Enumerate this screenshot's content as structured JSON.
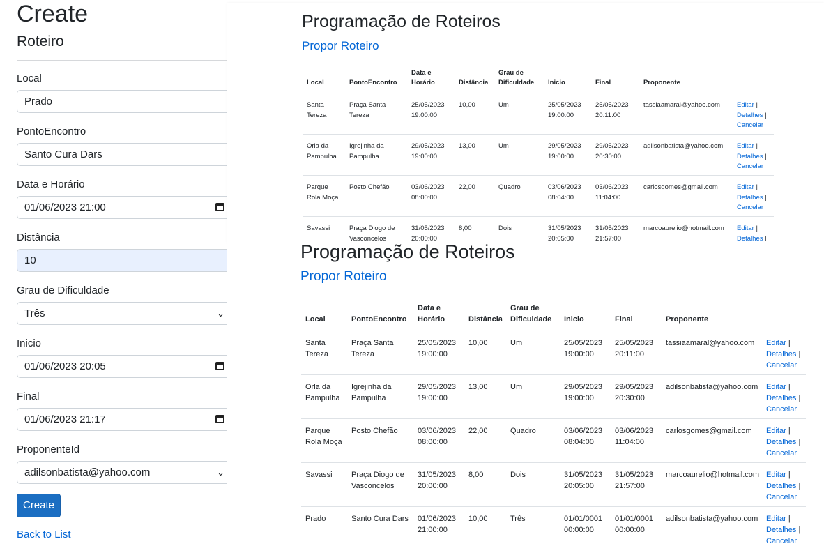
{
  "create_form": {
    "title": "Create",
    "subtitle": "Roteiro",
    "fields": {
      "local": {
        "label": "Local",
        "value": "Prado"
      },
      "ponto": {
        "label": "PontoEncontro",
        "value": "Santo Cura Dars"
      },
      "data": {
        "label": "Data e Horário",
        "value": "01/06/2023 21:00"
      },
      "distancia": {
        "label": "Distância",
        "value": "10"
      },
      "grau": {
        "label": "Grau de Dificuldade",
        "value": "Três"
      },
      "inicio": {
        "label": "Inicio",
        "value": "01/06/2023 20:05"
      },
      "final": {
        "label": "Final",
        "value": "01/06/2023 21:17"
      },
      "proponente": {
        "label": "ProponenteId",
        "value": "adilsonbatista@yahoo.com"
      }
    },
    "submit_label": "Create",
    "back_link": "Back to List"
  },
  "list_before": {
    "title": "Programação de Roteiros",
    "propose_link": "Propor Roteiro",
    "headers": [
      "Local",
      "PontoEncontro",
      "Data e\nHorário",
      "Distância",
      "Grau de\nDificuldade",
      "Inicio",
      "Final",
      "Proponente",
      ""
    ],
    "rows": [
      {
        "local": "Santa\nTereza",
        "ponto": "Praça Santa\nTereza",
        "data": "25/05/2023\n19:00:00",
        "distancia": "10,00",
        "grau": "Um",
        "inicio": "25/05/2023\n19:00:00",
        "final": "25/05/2023\n20:11:00",
        "proponente": "tassiaamaral@yahoo.com"
      },
      {
        "local": "Orla da\nPampulha",
        "ponto": "Igrejinha da\nPampulha",
        "data": "29/05/2023\n19:00:00",
        "distancia": "13,00",
        "grau": "Um",
        "inicio": "29/05/2023\n19:00:00",
        "final": "29/05/2023\n20:30:00",
        "proponente": "adilsonbatista@yahoo.com"
      },
      {
        "local": "Parque\nRola Moça",
        "ponto": "Posto Chefão",
        "data": "03/06/2023\n08:00:00",
        "distancia": "22,00",
        "grau": "Quadro",
        "inicio": "03/06/2023\n08:04:00",
        "final": "03/06/2023\n11:04:00",
        "proponente": "carlosgomes@gmail.com"
      },
      {
        "local": "Savassi",
        "ponto": "Praça Diogo de\nVasconcelos",
        "data": "31/05/2023\n20:00:00",
        "distancia": "8,00",
        "grau": "Dois",
        "inicio": "31/05/2023\n20:05:00",
        "final": "31/05/2023\n21:57:00",
        "proponente": "marcoaurelio@hotmail.com"
      }
    ]
  },
  "list_after": {
    "title": "Programação de Roteiros",
    "propose_link": "Propor Roteiro",
    "headers": [
      "Local",
      "PontoEncontro",
      "Data e\nHorário",
      "Distância",
      "Grau de\nDificuldade",
      "Inicio",
      "Final",
      "Proponente",
      ""
    ],
    "rows": [
      {
        "local": "Santa\nTereza",
        "ponto": "Praça Santa\nTereza",
        "data": "25/05/2023\n19:00:00",
        "distancia": "10,00",
        "grau": "Um",
        "inicio": "25/05/2023\n19:00:00",
        "final": "25/05/2023\n20:11:00",
        "proponente": "tassiaamaral@yahoo.com"
      },
      {
        "local": "Orla da\nPampulha",
        "ponto": "Igrejinha da\nPampulha",
        "data": "29/05/2023\n19:00:00",
        "distancia": "13,00",
        "grau": "Um",
        "inicio": "29/05/2023\n19:00:00",
        "final": "29/05/2023\n20:30:00",
        "proponente": "adilsonbatista@yahoo.com"
      },
      {
        "local": "Parque\nRola Moça",
        "ponto": "Posto Chefão",
        "data": "03/06/2023\n08:00:00",
        "distancia": "22,00",
        "grau": "Quadro",
        "inicio": "03/06/2023\n08:04:00",
        "final": "03/06/2023\n11:04:00",
        "proponente": "carlosgomes@gmail.com"
      },
      {
        "local": "Savassi",
        "ponto": "Praça Diogo de\nVasconcelos",
        "data": "31/05/2023\n20:00:00",
        "distancia": "8,00",
        "grau": "Dois",
        "inicio": "31/05/2023\n20:05:00",
        "final": "31/05/2023\n21:57:00",
        "proponente": "marcoaurelio@hotmail.com"
      },
      {
        "local": "Prado",
        "ponto": "Santo Cura Dars",
        "data": "01/06/2023\n21:00:00",
        "distancia": "10,00",
        "grau": "Três",
        "inicio": "01/01/0001\n00:00:00",
        "final": "01/01/0001\n00:00:00",
        "proponente": "adilsonbatista@yahoo.com"
      }
    ]
  },
  "row_actions": {
    "edit": "Editar",
    "details": "Detalhes",
    "cancel": "Cancelar",
    "separator": "|"
  }
}
